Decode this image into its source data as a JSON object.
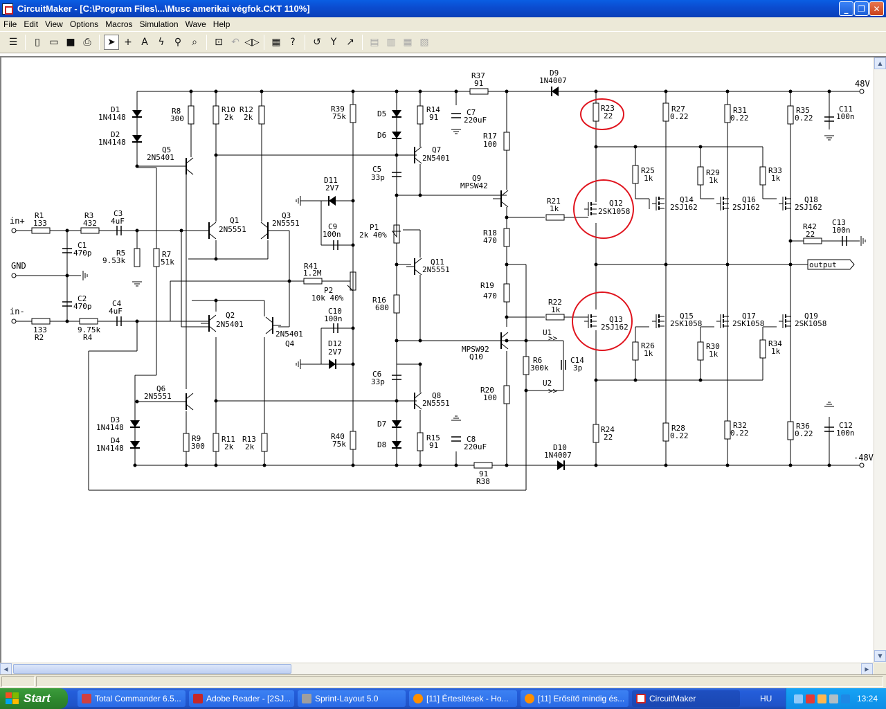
{
  "window": {
    "title": "CircuitMaker - [C:\\Program Files\\...\\Musc amerikai végfok.CKT 110%]",
    "min": "_",
    "max": "❐",
    "close": "✕"
  },
  "menu": [
    "File",
    "Edit",
    "View",
    "Options",
    "Macros",
    "Simulation",
    "Wave",
    "Help"
  ],
  "schematic": {
    "rail_pos": "48V",
    "rail_neg": "-48V",
    "labels": {
      "in_plus": "in+",
      "gnd": "GND",
      "in_minus": "in-",
      "output": "output",
      "R1": "R1",
      "R1v": "133",
      "R2": "R2",
      "R2v": "133",
      "R3": "R3",
      "R3v": "432",
      "R4": "R4",
      "R4v": "9.75k",
      "C1": "C1",
      "C1v": "470p",
      "C2": "C2",
      "C2v": "470p",
      "C3": "C3",
      "C3v": "4uF",
      "C4": "C4",
      "C4v": "4uF",
      "R5": "R5",
      "R5v": "9.53k",
      "R7": "R7",
      "R7v": "51k",
      "D1": "D1",
      "D1v": "1N4148",
      "D2": "D2",
      "D2v": "1N4148",
      "D3": "D3",
      "D3v": "1N4148",
      "D4": "D4",
      "D4v": "1N4148",
      "R8": "R8",
      "R8v": "300",
      "R9": "R9",
      "R9v": "300",
      "Q5": "Q5",
      "Q5v": "2N5401",
      "Q6": "Q6",
      "Q6v": "2N5551",
      "R10": "R10",
      "R10v": "2k",
      "R12": "R12",
      "R12v": "2k",
      "R11": "R11",
      "R11v": "2k",
      "R13": "R13",
      "R13v": "2k",
      "Q1": "Q1",
      "Q1v": "2N5551",
      "Q2": "Q2",
      "Q2v": "2N5401",
      "Q3": "Q3",
      "Q3v": "2N5551",
      "Q4": "Q4",
      "Q4v": "2N5401",
      "D11": "D11",
      "D11v": "2V7",
      "D12": "D12",
      "D12v": "2V7",
      "C9": "C9",
      "C9v": "100n",
      "C10": "C10",
      "C10v": "100n",
      "R41": "R41",
      "R41v": "1.2M",
      "P2": "P2",
      "P2v": "10k 40%",
      "R39": "R39",
      "R39v": "75k",
      "R40": "R40",
      "R40v": "75k",
      "D5": "D5",
      "D6": "D6",
      "D7": "D7",
      "D8": "D8",
      "C5": "C5",
      "C5v": "33p",
      "C6": "C6",
      "C6v": "33p",
      "P1": "P1",
      "P1v": "2k 40%",
      "R16": "R16",
      "R16v": "680",
      "R14": "R14",
      "R14v": "91",
      "R15": "R15",
      "R15v": "91",
      "Q7": "Q7",
      "Q7v": "2N5401",
      "Q8": "Q8",
      "Q8v": "2N5551",
      "Q11": "Q11",
      "Q11v": "2N5551",
      "C7": "C7",
      "C7v": "220uF",
      "C8": "C8",
      "C8v": "220uF",
      "R37": "R37",
      "R37v": "91",
      "R38": "R38",
      "R38v": "91",
      "R17": "R17",
      "R17v": "100",
      "R18": "R18",
      "R18v": "470",
      "R19": "R19",
      "R19v": "470",
      "R20": "R20",
      "R20v": "100",
      "Q9": "Q9",
      "Q9v": "MPSW42",
      "Q10": "Q10",
      "Q10v": "MPSW92",
      "D9": "D9",
      "D9v": "1N4007",
      "D10": "D10",
      "D10v": "1N4007",
      "R21": "R21",
      "R21v": "1k",
      "R22": "R22",
      "R22v": "1k",
      "R6": "R6",
      "R6v": "300k",
      "C14": "C14",
      "C14v": "3p",
      "U1": "U1",
      "U2": "U2",
      "R23": "R23",
      "R23v": "22",
      "R24": "R24",
      "R24v": "22",
      "Q12": "Q12",
      "Q12v": "2SK1058",
      "Q13": "Q13",
      "Q13v": "2SJ162",
      "R25": "R25",
      "R25v": "1k",
      "R26": "R26",
      "R26v": "1k",
      "R27": "R27",
      "R27v": "0.22",
      "R28": "R28",
      "R28v": "0.22",
      "Q14": "Q14",
      "Q14v": "2SJ162",
      "Q15": "Q15",
      "Q15v": "2SK1058",
      "R29": "R29",
      "R29v": "1k",
      "R30": "R30",
      "R30v": "1k",
      "R31": "R31",
      "R31v": "0.22",
      "R32": "R32",
      "R32v": "0.22",
      "Q16": "Q16",
      "Q16v": "2SJ162",
      "Q17": "Q17",
      "Q17v": "2SK1058",
      "R33": "R33",
      "R33v": "1k",
      "R34": "R34",
      "R34v": "1k",
      "R35": "R35",
      "R35v": "0.22",
      "R36": "R36",
      "R36v": "0.22",
      "Q18": "Q18",
      "Q18v": "2SJ162",
      "Q19": "Q19",
      "Q19v": "2SK1058",
      "C11": "C11",
      "C11v": "100n",
      "C12": "C12",
      "C12v": "100n",
      "R42": "R42",
      "R42v": "22",
      "C13": "C13",
      "C13v": "100n"
    }
  },
  "taskbar": {
    "start": "Start",
    "tasks": [
      {
        "label": "Total Commander 6.5...",
        "color": "#d04040"
      },
      {
        "label": "Adobe Reader - [2SJ...",
        "color": "#c62828"
      },
      {
        "label": "Sprint-Layout 5.0",
        "color": "#9e9e9e"
      },
      {
        "label": "[11] Értesítések - Ho...",
        "color": "#ff8f00"
      },
      {
        "label": "[11] Erősítő mindig és...",
        "color": "#ff8f00"
      },
      {
        "label": "CircuitMaker",
        "color": "#ffffff"
      }
    ],
    "lang": "HU",
    "clock": "13:24"
  },
  "colors": {
    "highlight_circle": "#e0141e",
    "titlebar": "#0b4dd1"
  }
}
